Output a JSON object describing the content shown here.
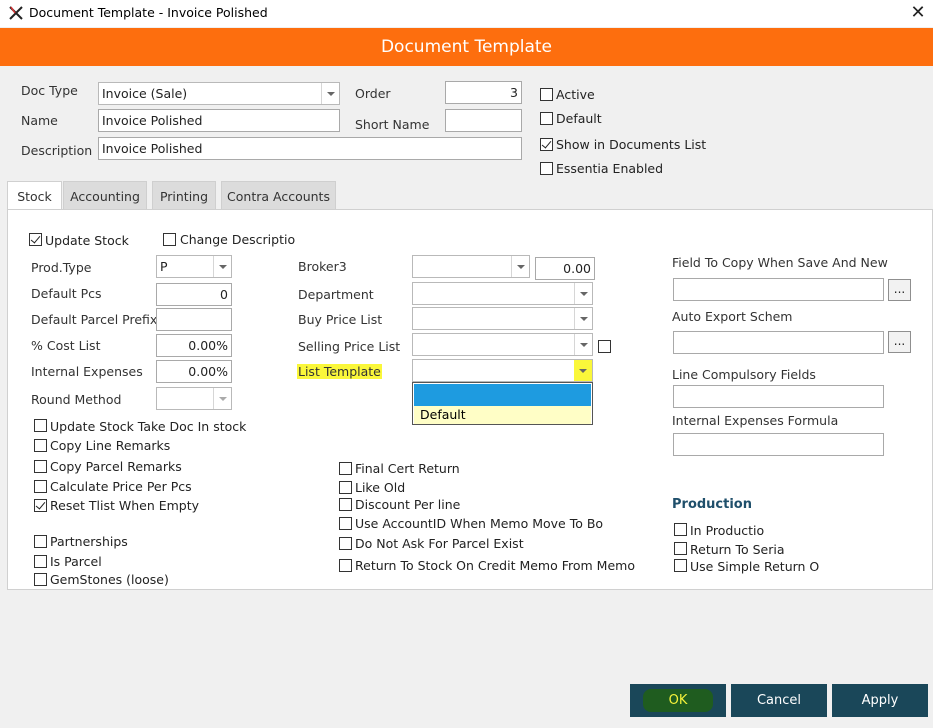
{
  "window": {
    "title": "Document Template - Invoice Polished"
  },
  "banner": {
    "title": "Document Template"
  },
  "header": {
    "doc_type_label": "Doc Type",
    "doc_type_value": "Invoice (Sale)",
    "name_label": "Name",
    "name_value": "Invoice Polished",
    "description_label": "Description",
    "description_value": "Invoice Polished",
    "order_label": "Order",
    "order_value": "3",
    "short_name_label": "Short Name",
    "short_name_value": "",
    "active_label": "Active",
    "active_checked": false,
    "default_label": "Default",
    "default_checked": false,
    "show_in_docs_label": "Show in Documents List",
    "show_in_docs_checked": true,
    "essentia_label": "Essentia Enabled",
    "essentia_checked": false
  },
  "tabs": [
    {
      "label": "Stock",
      "active": true
    },
    {
      "label": "Accounting",
      "active": false
    },
    {
      "label": "Printing",
      "active": false
    },
    {
      "label": "Contra Accounts",
      "active": false
    }
  ],
  "stock": {
    "update_stock_label": "Update Stock",
    "update_stock_checked": true,
    "change_description_label": "Change Descriptio",
    "change_description_checked": false,
    "prod_type_label": "Prod.Type",
    "prod_type_value": "P",
    "default_pcs_label": "Default Pcs",
    "default_pcs_value": "0",
    "default_parcel_prefix_label": "Default Parcel Prefix",
    "default_parcel_prefix_value": "",
    "cost_list_label": "% Cost List",
    "cost_list_value": "0.00%",
    "internal_expenses_label": "Internal Expenses",
    "internal_expenses_value": "0.00%",
    "round_method_label": "Round Method",
    "round_method_value": "",
    "broker3_label": "Broker3",
    "broker3_value": "",
    "broker3_amount": "0.00",
    "department_label": "Department",
    "buy_price_list_label": "Buy Price List",
    "selling_price_list_label": "Selling Price List",
    "list_template_label": "List Template",
    "list_template_options": [
      "",
      "Default"
    ],
    "left_checks": [
      {
        "label": "Update Stock Take Doc In stock",
        "checked": false
      },
      {
        "label": "Copy Line Remarks",
        "checked": false
      },
      {
        "label": "Copy Parcel Remarks",
        "checked": false
      },
      {
        "label": "Calculate Price Per Pcs",
        "checked": false
      },
      {
        "label": "Reset Tlist When Empty",
        "checked": true
      }
    ],
    "lower_left_checks": [
      {
        "label": "Partnerships",
        "checked": false
      },
      {
        "label": "Is Parcel",
        "checked": false
      },
      {
        "label": "GemStones (loose)",
        "checked": false
      }
    ],
    "middle_checks": [
      {
        "label": "Final Cert Return",
        "checked": false
      },
      {
        "label": "Like Old",
        "checked": false
      },
      {
        "label": "Discount Per line",
        "checked": false
      },
      {
        "label": "Use AccountID When Memo Move To Bo",
        "checked": false
      },
      {
        "label": "Do Not Ask For Parcel Exist",
        "checked": false
      },
      {
        "label": "Return To Stock On Credit Memo From Memo",
        "checked": false
      }
    ],
    "field_to_copy_label": "Field To Copy When Save And New",
    "field_to_copy_value": "",
    "auto_export_label": "Auto Export Schem",
    "auto_export_value": "",
    "line_compulsory_label": "Line Compulsory Fields",
    "line_compulsory_value": "",
    "internal_expenses_formula_label": "Internal Expenses Formula",
    "internal_expenses_formula_value": "",
    "ellipsis_label": "...",
    "production_heading": "Production",
    "production_checks": [
      {
        "label": "In Productio",
        "checked": false
      },
      {
        "label": "Return To Seria",
        "checked": false
      },
      {
        "label": "Use Simple Return O",
        "checked": false
      }
    ]
  },
  "footer": {
    "ok_label": "OK",
    "cancel_label": "Cancel",
    "apply_label": "Apply"
  },
  "colors": {
    "banner": "#fd6e0e",
    "button": "#1a4759",
    "highlight": "#faf73a",
    "dropdown_selected": "#1e9be0"
  }
}
